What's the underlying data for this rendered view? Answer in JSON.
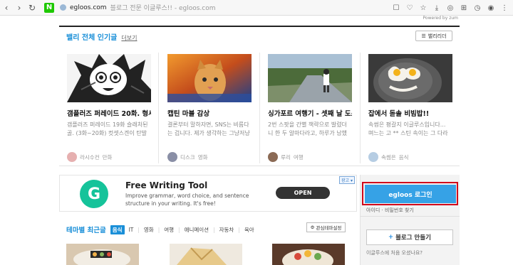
{
  "browser": {
    "url_domain": "egloos.com",
    "url_title": "블로그 전문 이글루스!! - egloos.com",
    "naver_letter": "N",
    "powered": "Powered by zum"
  },
  "popular": {
    "title": "밸리 전체 인기글",
    "more": "더보기",
    "list_toggle": "밸리리더",
    "cards": [
      {
        "title": "갬플러즈 퍼레이드 20화. 형세고...",
        "desc": "갬플러즈 퍼레이드 19화 슬래처된 골. (3화~20화) 컷셋스겐이 탄발문 3컷",
        "user": "라시수컨",
        "category": "만화"
      },
      {
        "title": "캡틴 마블 감상",
        "desc": "결론부터 말하자면, SNS는 비름다는 겁니다. 제가 생각하는 그냥저냥 무",
        "user": "디스크",
        "category": "영화"
      },
      {
        "title": "싱가포르 여행기 - 셋째 날 도스...",
        "desc": "2번 스팟을 간별 책략으로 발렸더니 한 두 알마다라고, 하루가 남했던 신나",
        "user": "루리",
        "category": "여행"
      },
      {
        "title": "잡에서 돋솔 비빔밥!!",
        "desc": "속썸은 평갈지 이글루스입니다... 며느는 고 ** 스틴 속이는 그 다라 달달",
        "user": "속썸은",
        "category": "음식"
      }
    ]
  },
  "ad": {
    "logo_letter": "G",
    "title": "Free Writing Tool",
    "desc": "Improve grammar, word choice, and sentence structure in your writing. It's free!",
    "button": "OPEN",
    "badge": "광고 ▾"
  },
  "login": {
    "button": "egloos 로그인",
    "find": "아이디 · 비밀번호 찾기",
    "make_blog": "블로그 만들기",
    "make_blog_plus": "+",
    "first_time": "이글루스에 처음 오셨나요?"
  },
  "theme": {
    "title": "테마별 최근글",
    "tabs": [
      "음식",
      "IT",
      "영화",
      "여행",
      "애니메이션",
      "자동차",
      "육아"
    ],
    "active_index": 0,
    "edit": "관심테마설정"
  },
  "colors": {
    "accent": "#1a8fd8",
    "login_btn": "#36a2e6",
    "highlight": "#d0021b",
    "grammarly": "#15c39a"
  }
}
